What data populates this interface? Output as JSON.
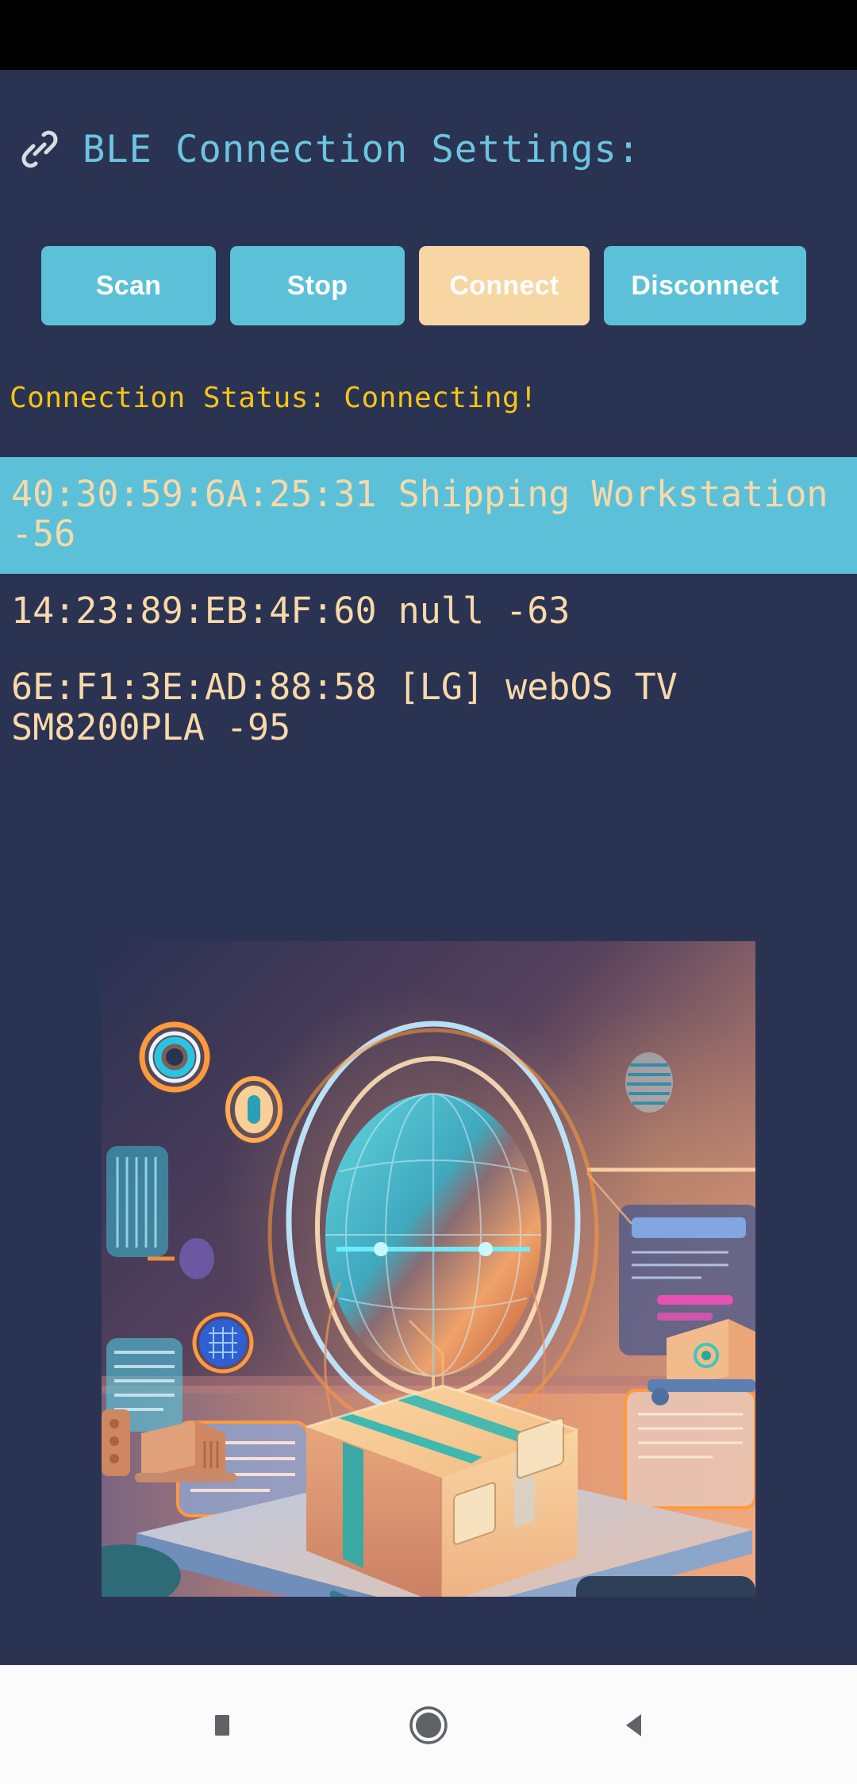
{
  "app": {
    "title": "BLE Connection Settings:",
    "title_icon": "link-icon",
    "background_color": "#2b3353",
    "accent_cyan": "#5cc1d8",
    "accent_peach": "#f7d6a4",
    "status_color": "#f5c518",
    "device_text_color": "#f8d9a8",
    "title_color": "#6cc5e0"
  },
  "status_bar": {
    "background_color": "#000000"
  },
  "controls": {
    "scan_label": "Scan",
    "stop_label": "Stop",
    "connect_label": "Connect",
    "disconnect_label": "Disconnect"
  },
  "status": {
    "text": "Connection Status: Connecting!"
  },
  "devices": [
    {
      "text": "40:30:59:6A:25:31 Shipping Workstation -56",
      "address": "40:30:59:6A:25:31",
      "name": "Shipping Workstation",
      "rssi": "-56",
      "selected": true
    },
    {
      "text": "14:23:89:EB:4F:60 null -63",
      "address": "14:23:89:EB:4F:60",
      "name": "null",
      "rssi": "-63",
      "selected": false
    },
    {
      "text": "6E:F1:3E:AD:88:58 [LG] webOS TV SM8200PLA -95",
      "address": "6E:F1:3E:AD:88:58",
      "name": "[LG] webOS TV SM8200PLA",
      "rssi": "-95",
      "selected": false
    }
  ],
  "illustration": {
    "description": "3D rendered shipping logistics scene: glowing cardboard parcel with teal strapping on a blue platform, holographic globe and interface panels in the background",
    "alt": "shipping-logistics-illustration"
  },
  "nav_bar": {
    "recents_label": "recents-square-icon",
    "home_label": "home-circle-icon",
    "back_label": "back-triangle-icon"
  }
}
